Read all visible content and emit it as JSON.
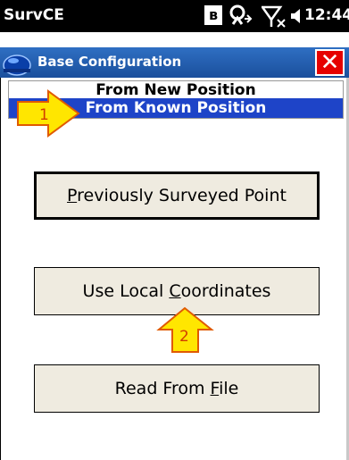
{
  "statusbar": {
    "app_name": "SurvCE",
    "time": "12:44",
    "icons": [
      "bluetooth-icon",
      "sync-icon",
      "no-signal-icon",
      "volume-icon",
      "battery-icon"
    ]
  },
  "titlebar": {
    "title": "Base Configuration",
    "close_label": "✕"
  },
  "listbox": {
    "items": [
      {
        "label": "From New Position",
        "selected": false
      },
      {
        "label": "From Known Position",
        "selected": true
      }
    ]
  },
  "buttons": {
    "previously_surveyed": {
      "before": "",
      "accel": "P",
      "after": "reviously Surveyed Point"
    },
    "use_local_coordinates": {
      "before": "Use Local ",
      "accel": "C",
      "after": "oordinates"
    },
    "read_from_file": {
      "before": "Read From ",
      "accel": "F",
      "after": "ile"
    }
  },
  "callouts": {
    "one": "1",
    "two": "2"
  },
  "colors": {
    "titlebar": "#1a4f9c",
    "selection": "#1e44c8",
    "button_face": "#efebe0",
    "close": "#e60000",
    "callout_fill": "#ffe600",
    "callout_stroke": "#e05a00"
  }
}
